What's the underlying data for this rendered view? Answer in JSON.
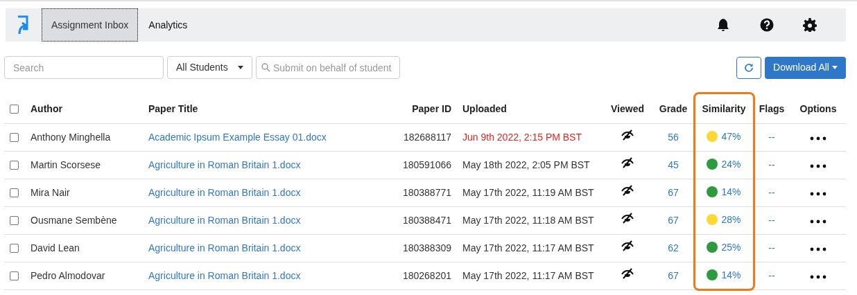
{
  "nav": {
    "tabs": [
      {
        "label": "Assignment Inbox",
        "selected": true
      },
      {
        "label": "Analytics",
        "selected": false
      }
    ]
  },
  "select_all": {
    "checked": false
  },
  "toolbar": {
    "search": {
      "placeholder": "Search"
    },
    "filter": {
      "value": "All Students"
    },
    "submit_search": {
      "placeholder": "Submit on behalf of student"
    },
    "download_button": "Download All"
  },
  "table": {
    "columns": [
      "Author",
      "Paper Title",
      "Paper ID",
      "Uploaded",
      "Viewed",
      "Grade",
      "Similarity",
      "Flags",
      "Options"
    ],
    "rows": [
      {
        "checked": false,
        "author": "Anthony Minghella",
        "title": "Academic Ipsum Example Essay 01.docx",
        "paper_id": "182688117",
        "uploaded": "Jun 9th 2022, 2:15 PM BST",
        "late": true,
        "grade": "56",
        "similarity": "47%",
        "color": "#fdd835",
        "flags": "--"
      },
      {
        "checked": false,
        "author": "Martin Scorsese",
        "title": "Agriculture in Roman Britain 1.docx",
        "paper_id": "180591066",
        "uploaded": "May 18th 2022, 2:05 PM BST",
        "late": false,
        "grade": "45",
        "similarity": "24%",
        "color": "#2e9a3e",
        "flags": "--"
      },
      {
        "checked": false,
        "author": "Mira Nair",
        "title": "Agriculture in Roman Britain 1.docx",
        "paper_id": "180388771",
        "uploaded": "May 17th 2022, 11:19 AM BST",
        "late": false,
        "grade": "67",
        "similarity": "14%",
        "color": "#2e9a3e",
        "flags": "--"
      },
      {
        "checked": false,
        "author": "Ousmane Sembène",
        "title": "Agriculture in Roman Britain 1.docx",
        "paper_id": "180388471",
        "uploaded": "May 17th 2022, 11:18 AM BST",
        "late": false,
        "grade": "67",
        "similarity": "28%",
        "color": "#fdd835",
        "flags": "--"
      },
      {
        "checked": false,
        "author": "David Lean",
        "title": "Agriculture in Roman Britain 1.docx",
        "paper_id": "180388309",
        "uploaded": "May 17th 2022, 11:17 AM BST",
        "late": false,
        "grade": "62",
        "similarity": "25%",
        "color": "#2e9a3e",
        "flags": "--"
      },
      {
        "checked": false,
        "author": "Pedro Almodovar",
        "title": "Agriculture in Roman Britain 1.docx",
        "paper_id": "180268201",
        "uploaded": "May 17th 2022, 11:17 AM BST",
        "late": false,
        "grade": "67",
        "similarity": "14%",
        "color": "#2e9a3e",
        "flags": "--"
      }
    ]
  }
}
